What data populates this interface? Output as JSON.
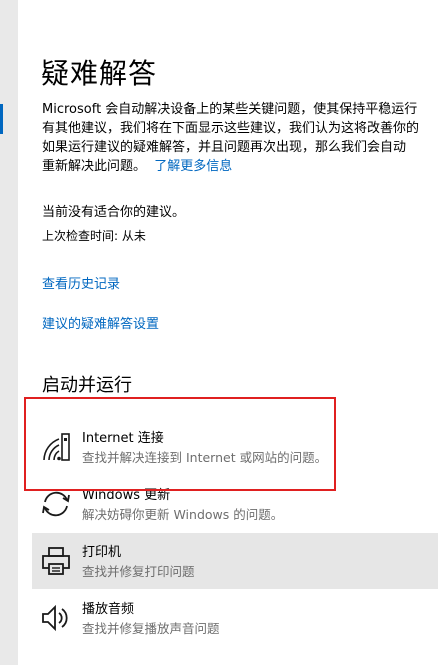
{
  "page": {
    "title": "疑难解答",
    "description_lines": [
      "Microsoft 会自动解决设备上的某些关键问题，使其保持平稳运行",
      "有其他建议，我们将在下面显示这些建议，我们认为这将改善你的",
      "如果运行建议的疑难解答，并且问题再次出现，那么我们会自动",
      "重新解决此问题。"
    ],
    "learn_more_link": "了解更多信息",
    "status_text": "当前没有适合你的建议。",
    "last_check_text": "上次检查时间: 从未",
    "history_link": "查看历史记录",
    "settings_link": "建议的疑难解答设置"
  },
  "get_up_and_running": {
    "title": "启动并运行",
    "items": [
      {
        "icon": "wifi-icon",
        "title": "Internet 连接",
        "subtitle": "查找并解决连接到 Internet 或网站的问题。"
      },
      {
        "icon": "windows-update-icon",
        "title": "Windows 更新",
        "subtitle": "解决妨碍你更新 Windows 的问题。"
      },
      {
        "icon": "printer-icon",
        "title": "打印机",
        "subtitle": "查找并修复打印问题"
      },
      {
        "icon": "speaker-icon",
        "title": "播放音频",
        "subtitle": "查找并修复播放声音问题"
      }
    ]
  },
  "colors": {
    "link": "#0067c0",
    "highlight_annotation": "#e02020",
    "hover_background": "#e6e6e6"
  }
}
